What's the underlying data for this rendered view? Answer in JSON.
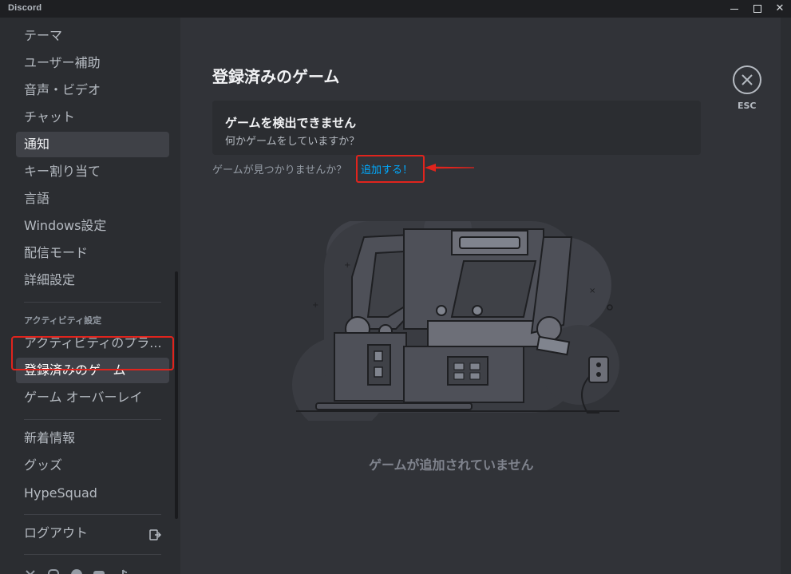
{
  "window": {
    "title": "Discord",
    "minimize": "",
    "maximize": "",
    "close": "✕"
  },
  "sidebar": {
    "items_top": [
      "テーマ",
      "ユーザー補助",
      "音声・ビデオ",
      "チャット",
      "通知",
      "キー割り当て",
      "言語",
      "Windows設定",
      "配信モード",
      "詳細設定"
    ],
    "activity_header": "アクティビティ設定",
    "activity_items": [
      "アクティビティのプラ...",
      "登録済みのゲーム",
      "ゲーム オーバーレイ"
    ],
    "misc_items": [
      "新着情報",
      "グッズ",
      "HypeSquad"
    ],
    "logout_label": "ログアウト",
    "social_icons": [
      "x-icon",
      "instagram-icon",
      "facebook-icon",
      "youtube-icon",
      "tiktok-icon"
    ]
  },
  "main": {
    "title": "登録済みのゲーム",
    "card": {
      "title": "ゲームを検出できません",
      "subtitle": "何かゲームをしていますか？"
    },
    "find_prompt": "ゲームが見つかりませんか？",
    "add_link": "追加する！",
    "empty_message": "ゲームが追加されていません"
  },
  "close": {
    "icon": "close-icon",
    "label": "ESC"
  },
  "colors": {
    "accent_link": "#00a8fc",
    "highlight": "#e0241d",
    "background": "#313338",
    "sidebar": "#2b2d31"
  }
}
